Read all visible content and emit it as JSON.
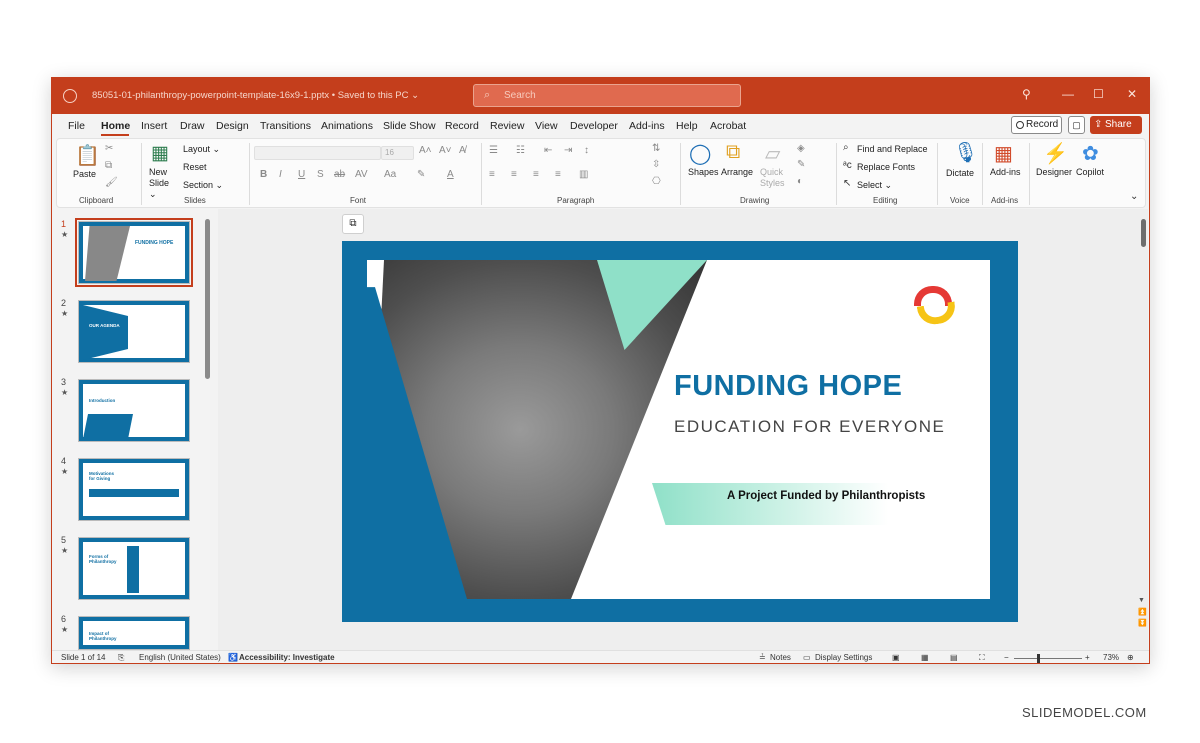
{
  "window": {
    "filename": "85051-01-philanthropy-powerpoint-template-16x9-1.pptx • Saved to this PC ⌄",
    "search_placeholder": "Search",
    "controls": {
      "minimize": "—",
      "maximize": "☐",
      "close": "✕",
      "lightbulb": "💡"
    }
  },
  "ribbon_tabs": [
    "File",
    "Home",
    "Insert",
    "Draw",
    "Design",
    "Transitions",
    "Animations",
    "Slide Show",
    "Record",
    "Review",
    "View",
    "Developer",
    "Add-ins",
    "Help",
    "Acrobat"
  ],
  "active_tab": "Home",
  "header_buttons": {
    "record": "Record",
    "share": "Share ⌄"
  },
  "ribbon": {
    "clipboard": {
      "paste": "Paste",
      "label": "Clipboard"
    },
    "slides": {
      "new_slide": "New Slide ⌄",
      "layout": "Layout ⌄",
      "reset": "Reset",
      "section": "Section ⌄",
      "label": "Slides"
    },
    "font": {
      "size": "16",
      "label": "Font"
    },
    "paragraph": {
      "label": "Paragraph"
    },
    "drawing": {
      "shapes": "Shapes",
      "arrange": "Arrange",
      "quick_styles": "Quick Styles",
      "label": "Drawing"
    },
    "editing": {
      "find_replace": "Find and Replace",
      "replace_fonts": "Replace Fonts",
      "select": "Select ⌄",
      "label": "Editing"
    },
    "voice": {
      "dictate": "Dictate",
      "label": "Voice"
    },
    "addins": {
      "addins": "Add-ins",
      "label": "Add-ins"
    },
    "designer": "Designer",
    "copilot": "Copilot"
  },
  "thumbnails": [
    {
      "num": "1",
      "title": "FUNDING HOPE"
    },
    {
      "num": "2",
      "title": "OUR AGENDA"
    },
    {
      "num": "3",
      "title": "Introduction"
    },
    {
      "num": "4",
      "title": "Motivations for Giving"
    },
    {
      "num": "5",
      "title": "Forms of Philanthropy"
    },
    {
      "num": "6",
      "title": "Impact of Philanthropy"
    }
  ],
  "slide": {
    "title": "FUNDING HOPE",
    "subtitle": "EDUCATION FOR EVERYONE",
    "tagline": "A Project Funded by Philanthropists"
  },
  "statusbar": {
    "slide_count": "Slide 1 of 14",
    "language": "English (United States)",
    "accessibility": "Accessibility: Investigate",
    "notes": "Notes",
    "display_settings": "Display Settings",
    "zoom": "73%"
  },
  "watermark": "SLIDEMODEL.COM",
  "colors": {
    "accent": "#c43e1c",
    "slide_blue": "#0f6fa3",
    "teal": "#8fe0c8"
  }
}
